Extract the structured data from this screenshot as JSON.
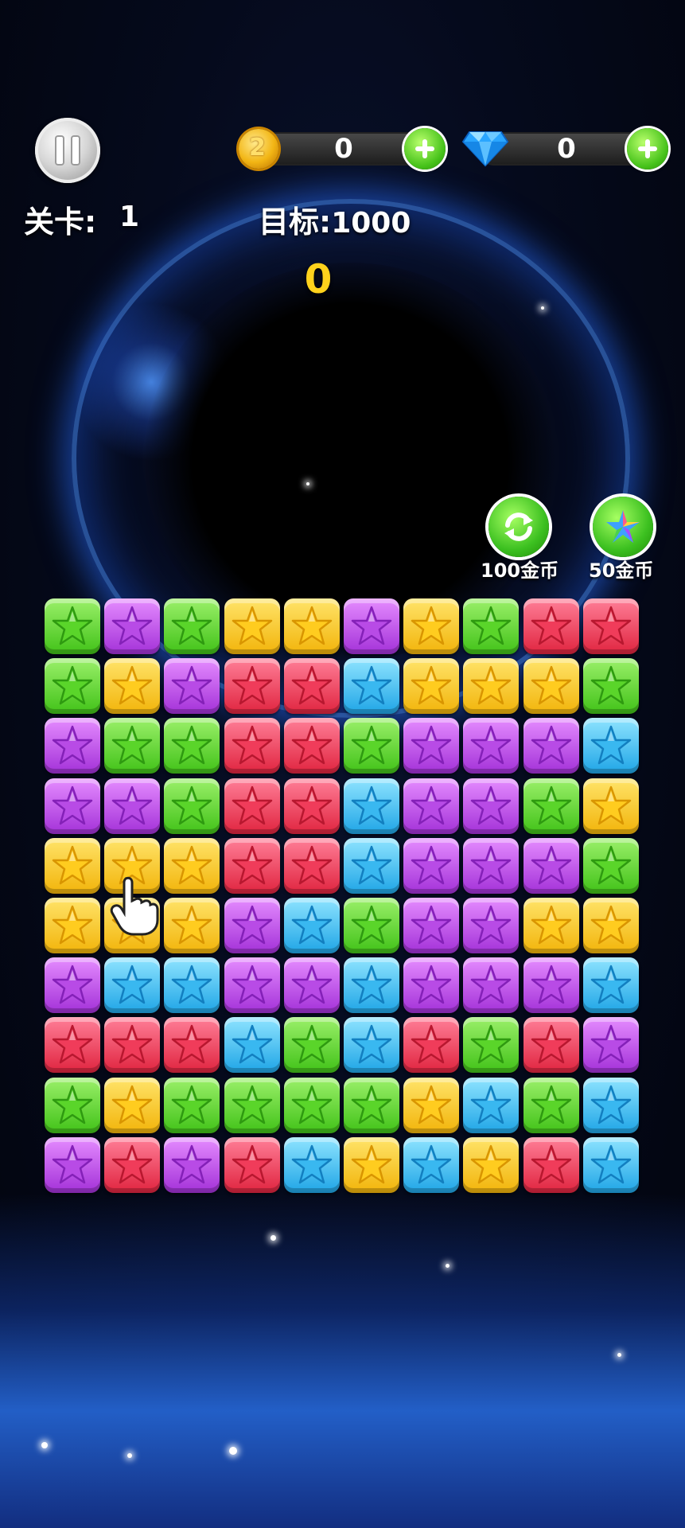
{
  "hud": {
    "level_label": "关卡:",
    "level_value": "1",
    "coins": "0",
    "gems": "0",
    "target_label": "目标:",
    "target_value": "1000",
    "score": "0"
  },
  "tools": {
    "refresh_cost": "100金币",
    "colorstar_cost": "50金币"
  },
  "icons": [
    "pause-icon",
    "coin-icon",
    "gem-icon",
    "plus-icon",
    "refresh-icon",
    "color-star-icon",
    "star-icon",
    "pointer-hand-icon"
  ],
  "colors": {
    "green": "#41c218",
    "purple": "#a331d8",
    "yellow": "#f2b40a",
    "red": "#e0243f",
    "blue": "#1fa5e6",
    "score": "#ffd21c"
  },
  "board": {
    "rows": 10,
    "cols": 10,
    "cells": [
      [
        "green",
        "purple",
        "green",
        "yellow",
        "yellow",
        "purple",
        "yellow",
        "green",
        "red",
        "red"
      ],
      [
        "green",
        "yellow",
        "purple",
        "red",
        "red",
        "blue",
        "yellow",
        "yellow",
        "yellow",
        "green"
      ],
      [
        "purple",
        "green",
        "green",
        "red",
        "red",
        "green",
        "purple",
        "purple",
        "purple",
        "blue"
      ],
      [
        "purple",
        "purple",
        "green",
        "red",
        "red",
        "blue",
        "purple",
        "purple",
        "green",
        "yellow"
      ],
      [
        "yellow",
        "yellow",
        "yellow",
        "red",
        "red",
        "blue",
        "purple",
        "purple",
        "purple",
        "green"
      ],
      [
        "yellow",
        "yellow",
        "yellow",
        "purple",
        "blue",
        "green",
        "purple",
        "purple",
        "yellow",
        "yellow"
      ],
      [
        "purple",
        "blue",
        "blue",
        "purple",
        "purple",
        "blue",
        "purple",
        "purple",
        "purple",
        "blue"
      ],
      [
        "red",
        "red",
        "red",
        "blue",
        "green",
        "blue",
        "red",
        "green",
        "red",
        "purple"
      ],
      [
        "green",
        "yellow",
        "green",
        "green",
        "green",
        "green",
        "yellow",
        "blue",
        "green",
        "blue"
      ],
      [
        "purple",
        "red",
        "purple",
        "red",
        "blue",
        "yellow",
        "blue",
        "yellow",
        "red",
        "blue"
      ]
    ]
  }
}
